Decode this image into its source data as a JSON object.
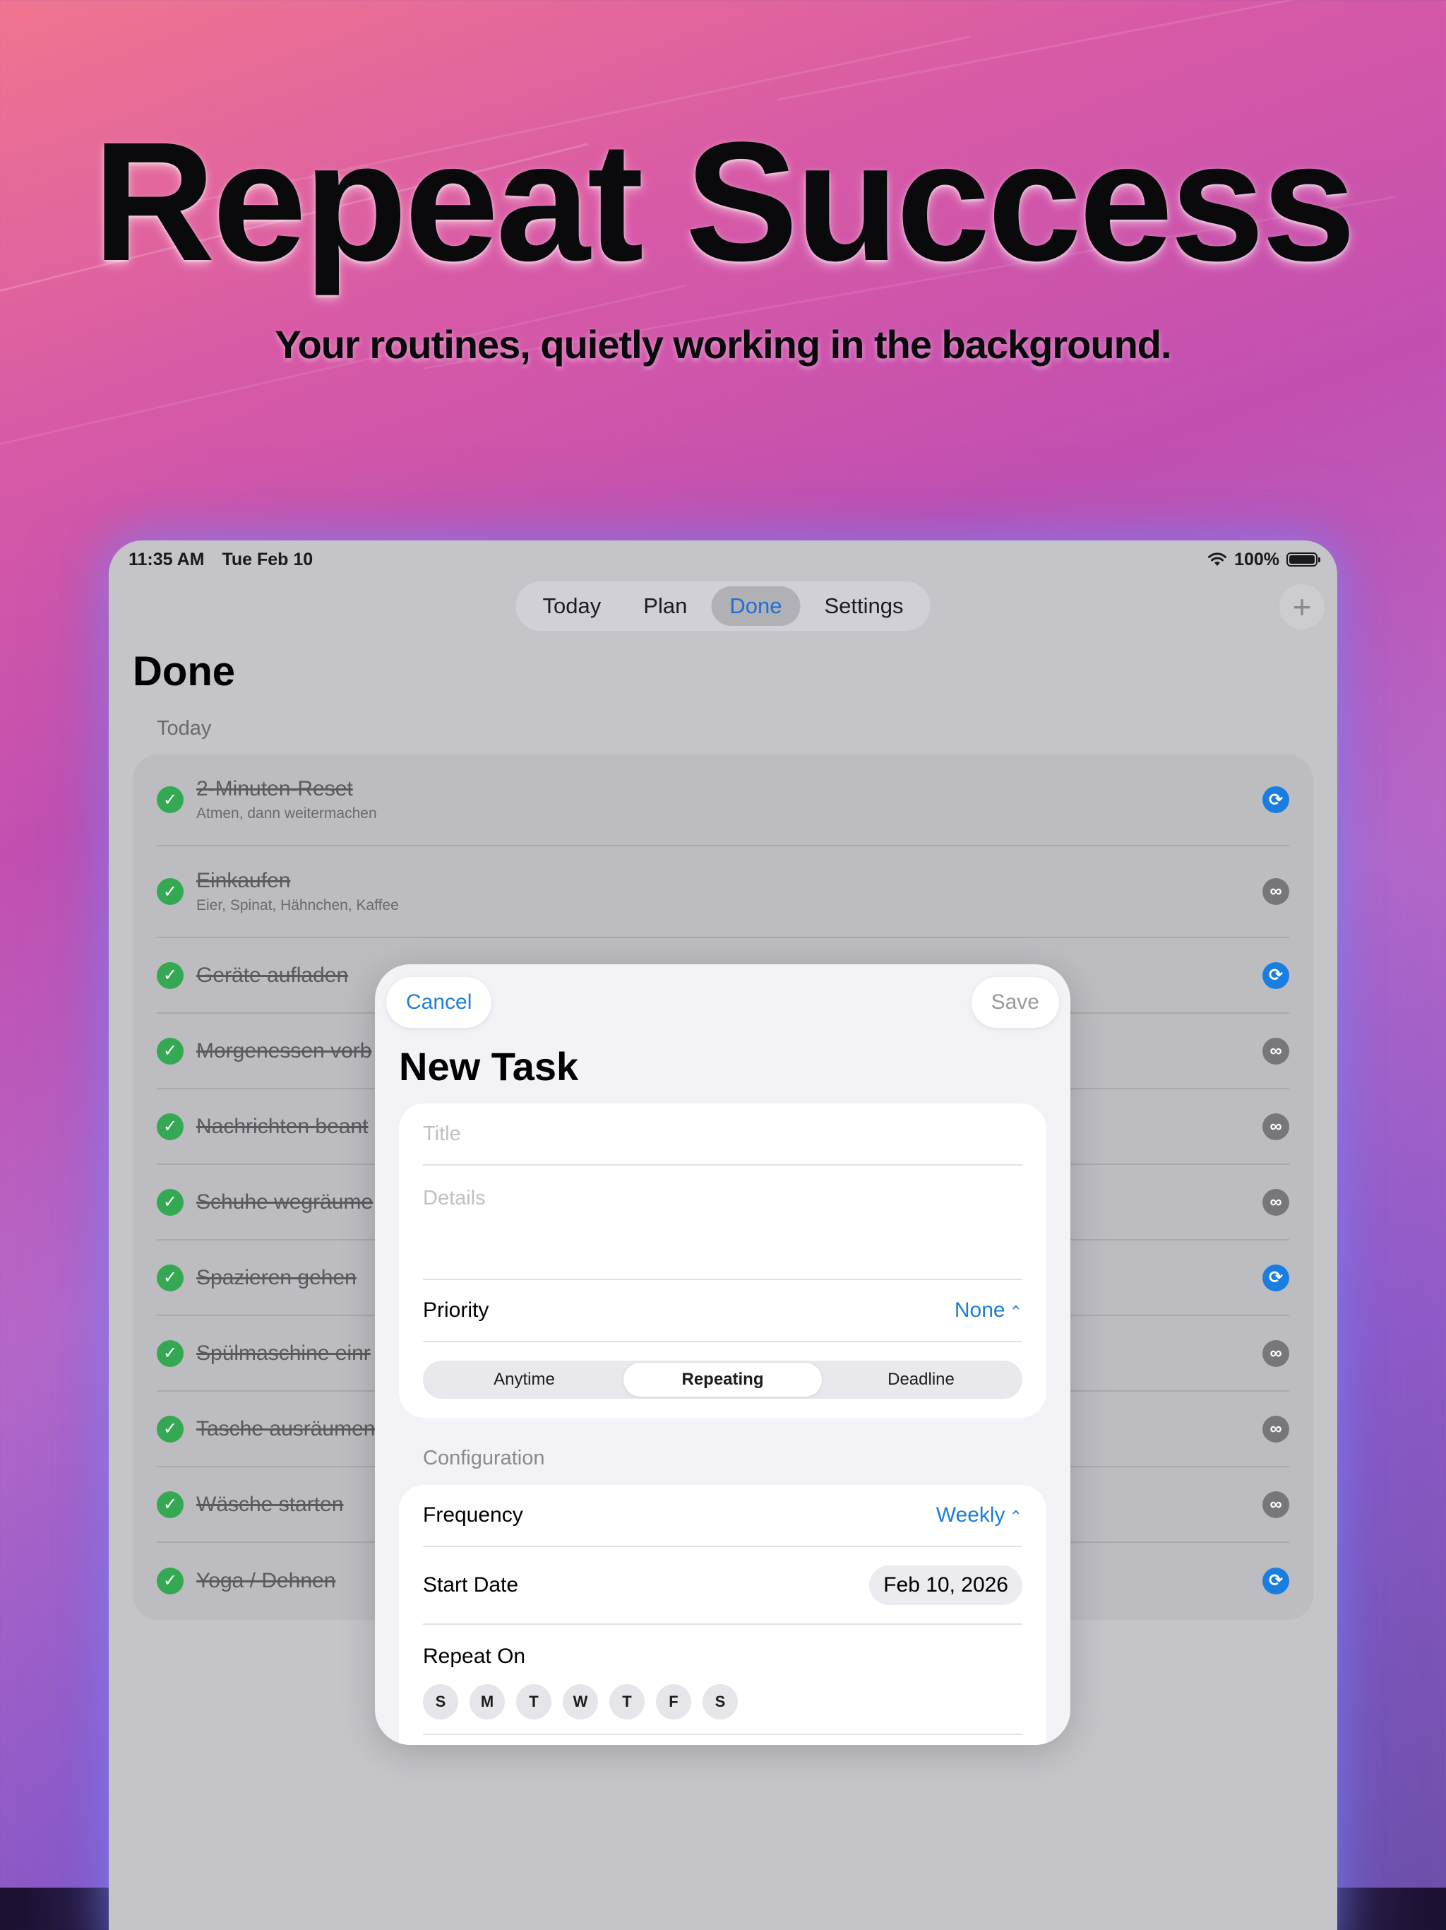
{
  "hero": {
    "title": "Repeat Success",
    "subtitle": "Your routines, quietly working in the background."
  },
  "status_bar": {
    "time": "11:35 AM",
    "date": "Tue Feb 10",
    "battery": "100%"
  },
  "tabs": [
    {
      "label": "Today",
      "active": false
    },
    {
      "label": "Plan",
      "active": false
    },
    {
      "label": "Done",
      "active": true
    },
    {
      "label": "Settings",
      "active": false
    }
  ],
  "add_button": "+",
  "page": {
    "title": "Done",
    "section": "Today"
  },
  "tasks": [
    {
      "title": "2-Minuten-Reset",
      "subtitle": "Atmen, dann weitermachen",
      "type": "repeat"
    },
    {
      "title": "Einkaufen",
      "subtitle": "Eier, Spinat, Hähnchen, Kaffee",
      "type": "infinite"
    },
    {
      "title": "Geräte aufladen",
      "type": "repeat"
    },
    {
      "title": "Morgenessen vorb",
      "type": "infinite"
    },
    {
      "title": "Nachrichten beant",
      "type": "infinite"
    },
    {
      "title": "Schuhe wegräume",
      "type": "infinite"
    },
    {
      "title": "Spazieren gehen",
      "type": "repeat"
    },
    {
      "title": "Spülmaschine einr",
      "type": "infinite"
    },
    {
      "title": "Tasche ausräumen",
      "type": "infinite"
    },
    {
      "title": "Wäsche starten",
      "type": "infinite"
    },
    {
      "title": "Yoga / Dehnen",
      "type": "repeat"
    }
  ],
  "icons": {
    "check": "✓",
    "repeat": "⟳",
    "infinite": "∞",
    "wifi": "wifi-icon",
    "updown": "⌃⌄"
  },
  "sheet": {
    "cancel": "Cancel",
    "save": "Save",
    "title": "New Task",
    "title_placeholder": "Title",
    "details_placeholder": "Details",
    "priority_label": "Priority",
    "priority_value": "None",
    "segments": [
      {
        "label": "Anytime",
        "active": false
      },
      {
        "label": "Repeating",
        "active": true
      },
      {
        "label": "Deadline",
        "active": false
      }
    ],
    "config_label": "Configuration",
    "frequency_label": "Frequency",
    "frequency_value": "Weekly",
    "start_label": "Start Date",
    "start_value": "Feb 10, 2026",
    "repeat_on_label": "Repeat On",
    "days": [
      "S",
      "M",
      "T",
      "W",
      "T",
      "F",
      "S"
    ]
  },
  "colors": {
    "accent_blue": "#1c7ed6",
    "check_green": "#34a853",
    "repeat_badge": "#1a7ee0",
    "infinite_badge": "#77777b"
  }
}
